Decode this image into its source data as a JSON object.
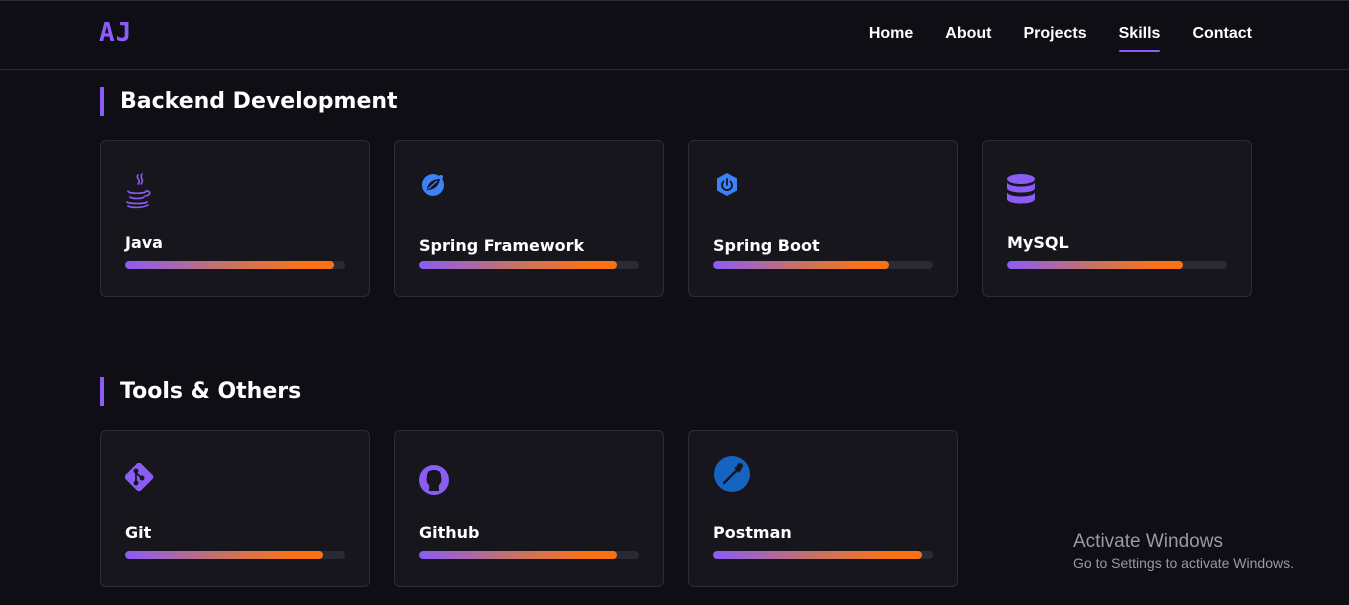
{
  "nav": {
    "logo": "AJ",
    "links": [
      "Home",
      "About",
      "Projects",
      "Skills",
      "Contact"
    ],
    "active": "Skills"
  },
  "sections": [
    {
      "title": "Backend Development",
      "skills": [
        {
          "name": "Java",
          "icon": "java-icon",
          "level": 0.95,
          "color": "#8b5cf6"
        },
        {
          "name": "Spring Framework",
          "icon": "spring-leaf-icon",
          "level": 0.9,
          "color": "#3b82f6"
        },
        {
          "name": "Spring Boot",
          "icon": "spring-boot-power-icon",
          "level": 0.8,
          "color": "#3b82f6"
        },
        {
          "name": "MySQL",
          "icon": "database-icon",
          "level": 0.8,
          "color": "#8b5cf6"
        }
      ]
    },
    {
      "title": "Tools & Others",
      "skills": [
        {
          "name": "Git",
          "icon": "git-icon",
          "level": 0.9,
          "color": "#8b5cf6"
        },
        {
          "name": "Github",
          "icon": "github-icon",
          "level": 0.9,
          "color": "#8b5cf6"
        },
        {
          "name": "Postman",
          "icon": "postman-icon",
          "level": 0.95,
          "color": "#1565c0"
        }
      ]
    }
  ],
  "watermark": {
    "line1": "Activate Windows",
    "line2": "Go to Settings to activate Windows."
  },
  "colors": {
    "accent": "#8b5cf6",
    "bar_end": "#f97316",
    "background": "#0f0e15",
    "card": "#16161c"
  }
}
